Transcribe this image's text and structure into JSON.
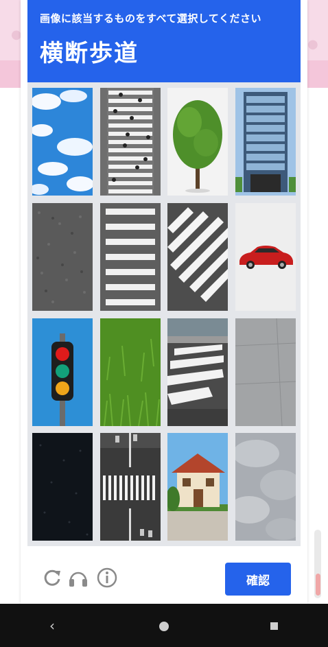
{
  "captcha": {
    "instruction": "画像に該当するものをすべて選択してください",
    "target": "横断歩道",
    "verify_label": "確認",
    "accent_color": "#2563eb",
    "tiles": [
      {
        "icon": "sky-icon"
      },
      {
        "icon": "crosswalk-pedestrians-icon"
      },
      {
        "icon": "tree-icon"
      },
      {
        "icon": "building-icon"
      },
      {
        "icon": "asphalt-icon"
      },
      {
        "icon": "crosswalk-icon"
      },
      {
        "icon": "crosswalk-diagonal-icon"
      },
      {
        "icon": "car-icon"
      },
      {
        "icon": "traffic-light-icon"
      },
      {
        "icon": "grass-icon"
      },
      {
        "icon": "crosswalk-street-icon"
      },
      {
        "icon": "sidewalk-icon"
      },
      {
        "icon": "dark-asphalt-icon"
      },
      {
        "icon": "crosswalk-aerial-icon"
      },
      {
        "icon": "house-icon"
      },
      {
        "icon": "clouds-icon"
      }
    ],
    "footer_icons": [
      "reload-icon",
      "audio-icon",
      "info-icon"
    ]
  },
  "navigation": {
    "icons": [
      "back-icon",
      "home-icon",
      "recent-apps-icon"
    ]
  }
}
